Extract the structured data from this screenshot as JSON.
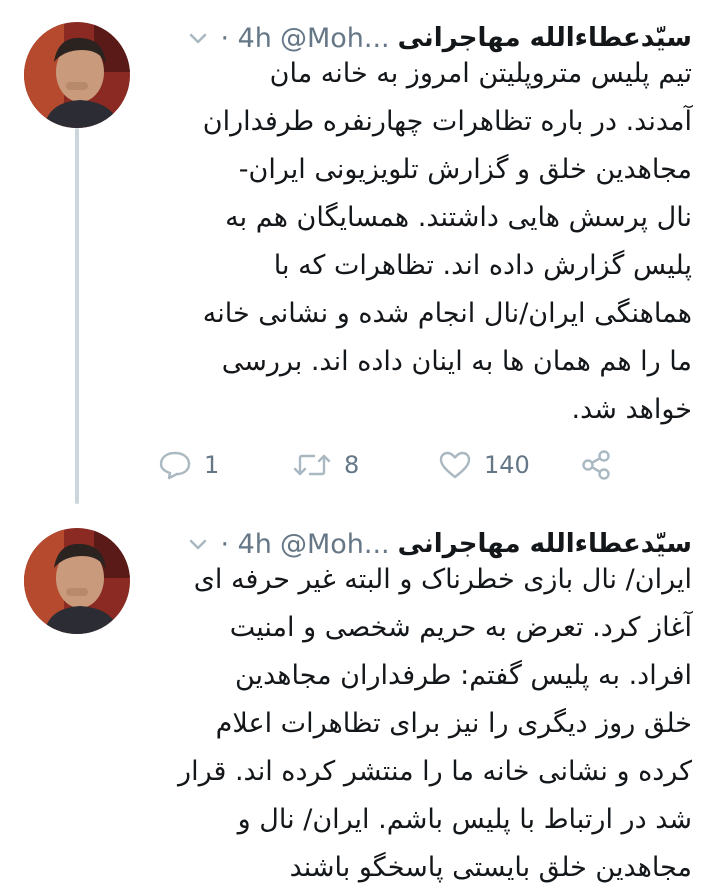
{
  "colors": {
    "secondary": "#657786",
    "text": "#14171a",
    "thread_line": "#ccd6dd"
  },
  "tweets": [
    {
      "author_name": "سیّدعطاءالله مهاجرانی",
      "handle": "@Moh...",
      "time": "· 4h",
      "text": "تیم پلیس متروپلیتن امروز به خانه مان\nآمدند. در باره تظاهرات چهارنفره طرفداران\nمجاهدین خلق و گزارش تلویزیونی ایران-\nنال پرسش هایی داشتند. همسایگان هم به\nپلیس گزارش داده اند. تظاهرات که با\nهماهنگی ایران/نال انجام شده و نشانی خانه\nما را هم همان ها به اینان داده اند. بررسی\nخواهد شد.",
      "actions": {
        "reply_count": "1",
        "retweet_count": "8",
        "like_count": "140"
      },
      "icons": [
        "chevron-down-icon",
        "reply-icon",
        "retweet-icon",
        "like-icon",
        "share-icon"
      ]
    },
    {
      "author_name": "سیّدعطاءالله مهاجرانی",
      "handle": "@Moh...",
      "time": "· 4h",
      "text": "ایران/ نال بازی خطرناک و البته غیر حرفه ای\nآغاز کرد. تعرض به حریم شخصی و امنیت\nافراد. به پلیس گفتم: طرفداران مجاهدین\nخلق روز دیگری را نیز برای تظاهرات اعلام\nکرده و نشانی خانه ما را منتشر کرده اند. قرار\nشد در ارتباط با پلیس باشم. ایران/ نال و\nمجاهدین خلق بایستی پاسخگو باشند",
      "icons": [
        "chevron-down-icon"
      ]
    }
  ]
}
